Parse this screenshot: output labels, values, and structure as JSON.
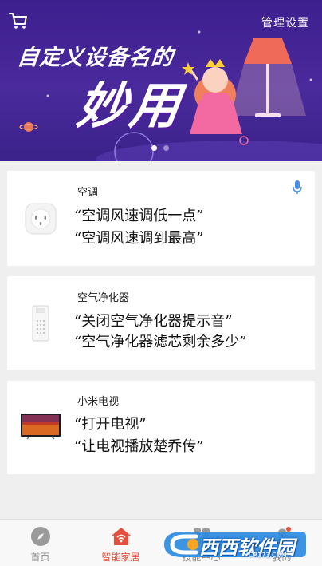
{
  "header": {
    "manage_label": "管理设置"
  },
  "banner": {
    "title": "自定义设备名的",
    "big_text": "妙用",
    "slide_count": 2,
    "active_slide": 1
  },
  "devices": [
    {
      "name": "空调",
      "icon": "air-conditioner-plug-icon",
      "commands": [
        "“空调风速调低一点”",
        "“空调风速调到最高”"
      ],
      "has_mic": true
    },
    {
      "name": "空气净化器",
      "icon": "air-purifier-icon",
      "commands": [
        "“关闭空气净化器提示音”",
        "“空气净化器滤芯剩余多少”"
      ]
    },
    {
      "name": "小米电视",
      "icon": "tv-icon",
      "commands": [
        "“打开电视”",
        "“让电视播放楚乔传”"
      ]
    }
  ],
  "bottom_nav": {
    "items": [
      {
        "label": "首页",
        "icon": "compass-icon"
      },
      {
        "label": "智能家居",
        "icon": "home-wifi-icon",
        "active": true
      },
      {
        "label": "技能中心",
        "icon": "skills-icon"
      },
      {
        "label": "我的",
        "icon": "profile-icon"
      }
    ]
  },
  "watermark": {
    "text": "西西软件园",
    "sub": "CR173.COM"
  },
  "colors": {
    "banner": "#3e1f8e",
    "accent": "#e4503d",
    "mic": "#4a90e2"
  }
}
